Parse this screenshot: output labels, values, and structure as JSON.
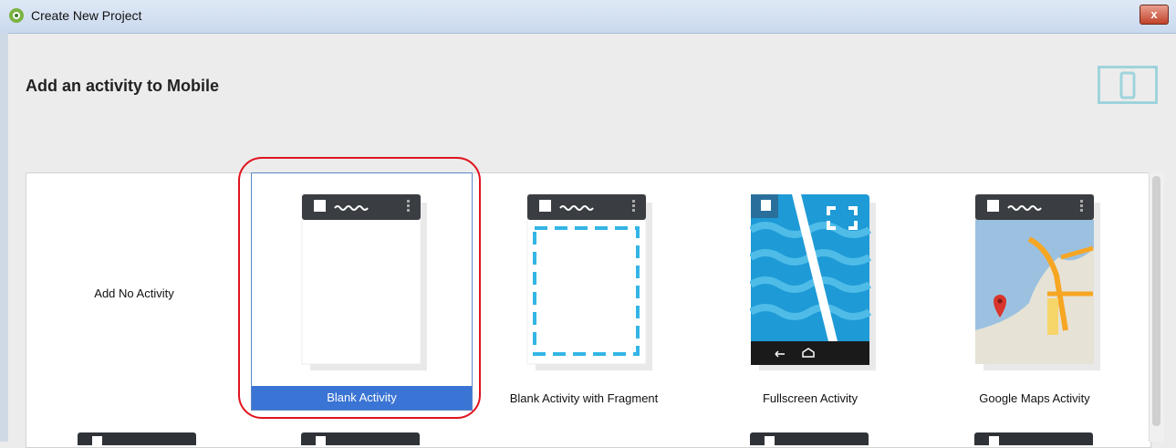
{
  "window": {
    "title": "Create New Project",
    "close_label": "x"
  },
  "header": {
    "title": "Add an activity to Mobile"
  },
  "activities": [
    {
      "label": "Add No Activity"
    },
    {
      "label": "Blank Activity",
      "selected": true
    },
    {
      "label": "Blank Activity with Fragment"
    },
    {
      "label": "Fullscreen Activity"
    },
    {
      "label": "Google Maps Activity"
    }
  ],
  "colors": {
    "selection": "#3a74d4",
    "highlight_outline": "#e0141e",
    "phone_bar": "#3a3d42",
    "fragment_dash": "#33b5e5",
    "ocean": "#1e9ad6"
  }
}
